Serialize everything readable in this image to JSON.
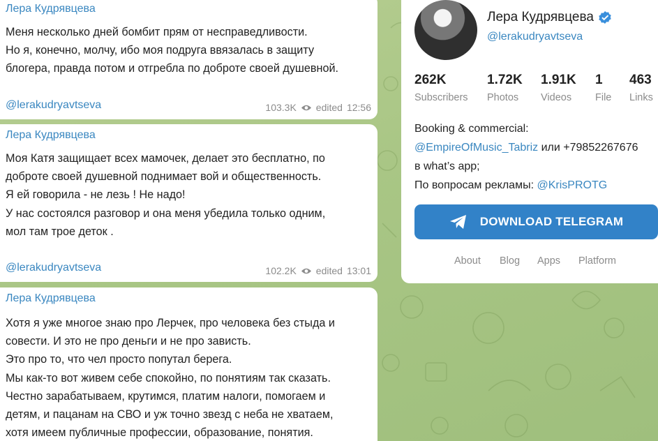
{
  "feed": {
    "messages": [
      {
        "author": "Лера Кудрявцева",
        "text": "Меня несколько дней бомбит прям от несправедливости.\nНо я, конечно, молчу, ибо моя подруга ввязалась в защиту\nблогера, правда потом и отгребла по доброте своей душевной.",
        "signature": "@lerakudryavtseva",
        "views": "103.3K",
        "status": "edited",
        "time": "12:56"
      },
      {
        "author": "Лера Кудрявцева",
        "text": "Моя Катя защищает всех мамочек, делает это бесплатно, по\nдоброте своей душевной поднимает вой и общественность.\nЯ ей говорила - не лезь ! Не надо!\nУ нас состоялся разговор и она меня убедила только одним,\nмол там трое деток .",
        "signature": "@lerakudryavtseva",
        "views": "102.2K",
        "status": "edited",
        "time": "13:01"
      },
      {
        "author": "Лера Кудрявцева",
        "text": "Хотя я уже многое знаю про Лерчек, про человека без стыда и\nсовести. И это не про деньги и не про зависть.\nЭто про то, что чел просто попутал берега.\nМы как-то вот живем себе спокойно, по понятиям так сказать.\nЧестно зарабатываем, крутимся, платим налоги, помогаем и\nдетям, и пацанам на СВО и уж точно звезд с неба не хватаем,\nхотя имеем публичные профессии, образование, понятия."
      }
    ]
  },
  "profile": {
    "name": "Лера Кудрявцева",
    "handle": "@lerakudryavtseva",
    "verified_icon": "verified-badge-icon",
    "stats": [
      {
        "value": "262K",
        "label": "Subscribers"
      },
      {
        "value": "1.72K",
        "label": "Photos"
      },
      {
        "value": "1.91K",
        "label": "Videos"
      },
      {
        "value": "1",
        "label": "File"
      },
      {
        "value": "463",
        "label": "Links"
      }
    ],
    "description": {
      "line1": "Booking & commercial:",
      "link1": "@EmpireOfMusic_Tabriz",
      "line2_rest": " или +79852267676",
      "line3": "в what’s app;",
      "line4": "По вопросам рекламы: ",
      "link2": "@KrisPROTG"
    },
    "download_button": "DOWNLOAD TELEGRAM",
    "footer": [
      "About",
      "Blog",
      "Apps",
      "Platform"
    ]
  },
  "colors": {
    "accent": "#3a87c0",
    "button": "#3282c8",
    "background": "#a9c685"
  }
}
